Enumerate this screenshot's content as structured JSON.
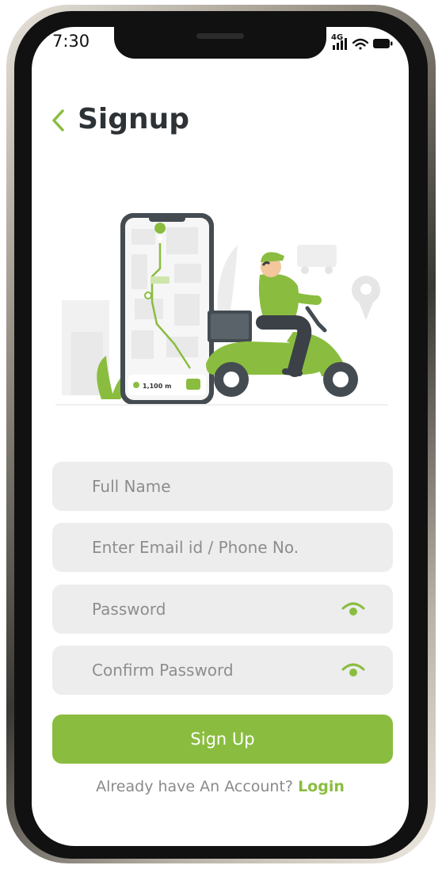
{
  "status_bar": {
    "time": "7:30",
    "network": "4G",
    "icons": [
      "signal-icon",
      "wifi-icon",
      "battery-icon"
    ]
  },
  "header": {
    "title": "Signup",
    "back_icon": "chevron-left-icon"
  },
  "illustration": {
    "distance_label": "1,100 m"
  },
  "form": {
    "full_name_placeholder": "Full Name",
    "email_placeholder": "Enter Email id / Phone No.",
    "password_placeholder": "Password",
    "confirm_password_placeholder": "Confirm Password",
    "password_toggle_icon": "eye-icon",
    "submit_label": "Sign Up"
  },
  "footer": {
    "prompt": "Already have An Account?",
    "login_link": "Login"
  },
  "colors": {
    "accent": "#8abd3f",
    "title": "#2d3236",
    "field_bg": "#ededed",
    "placeholder": "#8d8d8d"
  }
}
